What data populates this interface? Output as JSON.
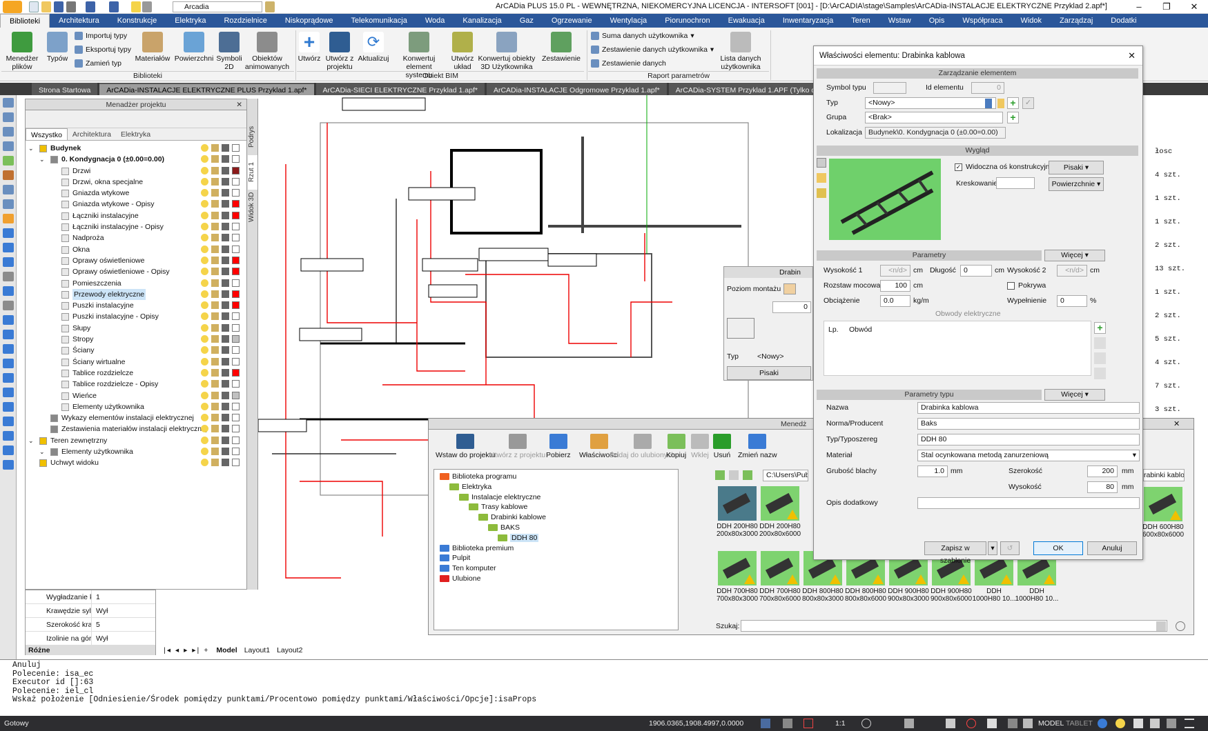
{
  "window": {
    "title": "ArCADia PLUS 15.0 PL - WEWNĘTRZNA, NIEKOMERCYJNA LICENCJA - INTERSOFT [001] - [D:\\ArCADIA\\stage\\Samples\\ArCADia-INSTALACJE ELEKTRYCZNE Przyklad 2.apf*]",
    "layer_combo": "Arcadia"
  },
  "ribbon_tabs": [
    "Biblioteki",
    "Architektura",
    "Konstrukcje",
    "Elektryka",
    "Rozdzielnice",
    "Niskoprądowe",
    "Telekomunikacja",
    "Woda",
    "Kanalizacja",
    "Gaz",
    "Ogrzewanie",
    "Wentylacja",
    "Piorunochron",
    "Ewakuacja",
    "Inwentaryzacja",
    "Teren",
    "Wstaw",
    "Opis",
    "Współpraca",
    "Widok",
    "Zarządzaj",
    "Dodatki"
  ],
  "ribbon": {
    "menedzer": "Menedżer plików",
    "typow": "Typów",
    "importuj": "Importuj typy",
    "eksportuj": "Eksportuj typy",
    "zamien": "Zamień typ",
    "materialow": "Materiałów",
    "powierzchni": "Powierzchni",
    "symboli": "Symboli 2D",
    "obiektow": "Obiektów animowanych",
    "group1": "Biblioteki",
    "utworz": "Utwórz",
    "utworz_projektu": "Utwórz z projektu",
    "aktualizuj": "Aktualizuj",
    "konwertuj": "Konwertuj element systemu",
    "utworz_uklad": "Utwórz układ",
    "konwertuj3d": "Konwertuj obiekty 3D Użytkownika",
    "zestawienie": "Zestawienie",
    "group2": "Obiekt BIM",
    "suma": "Suma danych użytkownika",
    "zest_uzyt": "Zestawienie danych użytkownika",
    "zest_danych": "Zestawienie danych",
    "lista": "Lista danych użytkownika",
    "group3": "Raport parametrów"
  },
  "doc_tabs": [
    "Strona Startowa",
    "ArCADia-INSTALACJE ELEKTRYCZNE PLUS Przyklad 1.apf*",
    "ArCADia-SIECI ELEKTRYCZNE Przyklad 1.apf*",
    "ArCADia-INSTALACJE Odgromowe Przyklad 1.apf*",
    "ArCADia-SYSTEM Przyklad 1.APF (Tylko do odczytu)*"
  ],
  "project_manager": {
    "title": "Menadżer projektu",
    "tabs": [
      "Wszystko",
      "Architektura",
      "Elektryka"
    ],
    "tree": [
      {
        "label": "Budynek",
        "level": 0,
        "bold": true
      },
      {
        "label": "0. Kondygnacja 0 (±0.00=0.00)",
        "level": 1,
        "bold": true
      },
      {
        "label": "Drzwi",
        "level": 2,
        "color": "#8b1a1a"
      },
      {
        "label": "Drzwi, okna specjalne",
        "level": 2,
        "color": "#ffffff"
      },
      {
        "label": "Gniazda wtykowe",
        "level": 2,
        "color": "#ffffff"
      },
      {
        "label": "Gniazda wtykowe - Opisy",
        "level": 2,
        "color": "#ff0000"
      },
      {
        "label": "Łączniki instalacyjne",
        "level": 2,
        "color": "#ff0000"
      },
      {
        "label": "Łączniki instalacyjne - Opisy",
        "level": 2,
        "color": "#ffffff"
      },
      {
        "label": "Nadproża",
        "level": 2,
        "color": "#ffffff"
      },
      {
        "label": "Okna",
        "level": 2,
        "color": "#ffffff"
      },
      {
        "label": "Oprawy oświetleniowe",
        "level": 2,
        "color": "#ff0000"
      },
      {
        "label": "Oprawy oświetleniowe - Opisy",
        "level": 2,
        "color": "#ff0000"
      },
      {
        "label": "Pomieszczenia",
        "level": 2,
        "color": "#ffffff"
      },
      {
        "label": "Przewody elektryczne",
        "level": 2,
        "color": "#ff0000",
        "selected": true
      },
      {
        "label": "Puszki instalacyjne",
        "level": 2,
        "color": "#ff0000"
      },
      {
        "label": "Puszki instalacyjne - Opisy",
        "level": 2,
        "color": "#ffffff"
      },
      {
        "label": "Słupy",
        "level": 2,
        "color": "#ffffff"
      },
      {
        "label": "Stropy",
        "level": 2,
        "color": "#c0c0c0"
      },
      {
        "label": "Ściany",
        "level": 2,
        "color": "#ffffff"
      },
      {
        "label": "Ściany wirtualne",
        "level": 2,
        "color": "#ffffff"
      },
      {
        "label": "Tablice rozdzielcze",
        "level": 2,
        "color": "#ff0000"
      },
      {
        "label": "Tablice rozdzielcze - Opisy",
        "level": 2,
        "color": "#ffffff"
      },
      {
        "label": "Wieńce",
        "level": 2,
        "color": "#c0c0c0"
      },
      {
        "label": "Elementy użytkownika",
        "level": 2,
        "color": "#ffffff"
      },
      {
        "label": "Wykazy elementów instalacji elektrycznej",
        "level": 1,
        "color": "#ffffff"
      },
      {
        "label": "Zestawienia materiałów instalacji elektrycznej",
        "level": 1,
        "color": "#ffffff"
      },
      {
        "label": "Teren zewnętrzny",
        "level": 0,
        "color": "#ffffff"
      },
      {
        "label": "Elementy użytkownika",
        "level": 1,
        "color": "#ffffff"
      },
      {
        "label": "Uchwyt widoku",
        "level": 0,
        "color": "#ffffff"
      }
    ]
  },
  "side_tabs": [
    "Podrys",
    "Rzut 1",
    "Widok 3D"
  ],
  "props_mini": [
    {
      "k": "Wygładzanie kr...",
      "v": "1"
    },
    {
      "k": "Krawędzie sylw...",
      "v": "Wył"
    },
    {
      "k": "Szerokość kra...",
      "v": "5"
    },
    {
      "k": "Izolinie na górze",
      "v": "Wył"
    }
  ],
  "props_mini_footer": "Różne",
  "layout_tabs": [
    "Model",
    "Layout1",
    "Layout2"
  ],
  "drabinka_mini": {
    "title": "Drabin",
    "poziom": "Poziom montażu",
    "typ_label": "Typ",
    "typ": "<Nowy>",
    "pisaki": "Pisaki",
    "val": "0"
  },
  "dialog": {
    "title": "Właściwości elementu: Drabinka kablowa",
    "sec_zarzadzanie": "Zarządzanie elementem",
    "symbol_typu": "Symbol typu",
    "id_elementu": "Id elementu",
    "id_value": "0",
    "typ_label": "Typ",
    "typ_value": "<Nowy>",
    "grupa_label": "Grupa",
    "grupa_value": "<Brak>",
    "lokalizacja_label": "Lokalizacja",
    "lokalizacja_value": "Budynek\\0. Kondygnacja 0 (±0.00=0.00)",
    "sec_wyglad": "Wygląd",
    "widoczna": "Widoczna oś konstrukcyjna",
    "pisaki": "Pisaki",
    "kreskowanie": "Kreskowanie",
    "powierzchnie": "Powierzchnie",
    "sec_parametry": "Parametry",
    "wiecej": "Więcej",
    "wysokosc1": "Wysokość 1",
    "nd": "<n/d>",
    "cm": "cm",
    "dlugosc": "Długość",
    "dlugosc_v": "0",
    "wysokosc2": "Wysokość 2",
    "rozstaw": "Rozstaw mocowań",
    "rozstaw_v": "100",
    "pokrywa": "Pokrywa",
    "obciazenie": "Obciążenie",
    "obciazenie_v": "0.0",
    "kgm": "kg/m",
    "wypelnienie": "Wypełnienie",
    "wypelnienie_v": "0",
    "pct": "%",
    "obwody": "Obwody elektryczne",
    "lp": "Lp.",
    "obwod": "Obwód",
    "sec_param_typu": "Parametry typu",
    "nazwa": "Nazwa",
    "nazwa_v": "Drabinka kablowa",
    "norma": "Norma/Producent",
    "norma_v": "Baks",
    "typ_typoszereg": "Typ/Typoszereg",
    "typ_typoszereg_v": "DDH 80",
    "material": "Materiał",
    "material_v": "Stal ocynkowana metodą zanurzeniową",
    "grubosc": "Grubość blachy",
    "grubosc_v": "1.0",
    "mm": "mm",
    "szerokosc": "Szerokość",
    "szerokosc_v": "200",
    "wysokosc": "Wysokość",
    "wysokosc_v": "80",
    "opis": "Opis dodatkowy",
    "zapisz": "Zapisz w szablonie",
    "ok": "OK",
    "anuluj": "Anuluj"
  },
  "library": {
    "title": "Menedż",
    "tools": [
      "Wstaw do projektu",
      "Utwórz z projektu",
      "Pobierz",
      "Właściwości",
      "Dodaj do ulubionych",
      "Kopiuj",
      "Wklej",
      "Usuń",
      "Zmień nazw"
    ],
    "path": "C:\\Users\\Public\\",
    "path_right": "rabinki kablowe\\BAKS",
    "tree": [
      {
        "label": "Biblioteka programu",
        "level": 0
      },
      {
        "label": "Elektryka",
        "level": 1
      },
      {
        "label": "Instalacje elektryczne",
        "level": 2
      },
      {
        "label": "Trasy kablowe",
        "level": 3
      },
      {
        "label": "Drabinki kablowe",
        "level": 4
      },
      {
        "label": "BAKS",
        "level": 5
      },
      {
        "label": "DDH 80",
        "level": 6,
        "selected": true
      },
      {
        "label": "Biblioteka premium",
        "level": 0
      },
      {
        "label": "Pulpit",
        "level": 0
      },
      {
        "label": "Ten komputer",
        "level": 0
      },
      {
        "label": "Ulubione",
        "level": 0
      }
    ],
    "thumbs_row1": [
      {
        "l1": "DDH 200H80",
        "l2": "200x80x3000"
      },
      {
        "l1": "DDH 200H80",
        "l2": "200x80x6000"
      }
    ],
    "thumb_right": {
      "l1": "DDH 600H80",
      "l2": "600x80x6000"
    },
    "thumbs_row2": [
      {
        "l1": "DDH 700H80",
        "l2": "700x80x3000"
      },
      {
        "l1": "DDH 700H80",
        "l2": "700x80x6000"
      },
      {
        "l1": "DDH 800H80",
        "l2": "800x80x3000"
      },
      {
        "l1": "DDH 800H80",
        "l2": "800x80x6000"
      },
      {
        "l1": "DDH 900H80",
        "l2": "900x80x3000"
      },
      {
        "l1": "DDH 900H80",
        "l2": "900x80x6000"
      },
      {
        "l1": "DDH",
        "l2": "1000H80 10..."
      },
      {
        "l1": "DDH",
        "l2": "1000H80 10..."
      }
    ],
    "search_label": "Szukaj:"
  },
  "bg_table": [
    "łosc",
    "4 szt.",
    "1 szt.",
    "1 szt.",
    "2 szt.",
    "13 szt.",
    "1 szt.",
    "2 szt.",
    "5 szt.",
    "4 szt.",
    "7 szt.",
    "3 szt."
  ],
  "command_lines": [
    "Anuluj",
    "Polecenie: isa_ec",
    "Executor id []:63",
    "Polecenie: iel_cl",
    "Wskaż położenie [Odniesienie/Środek pomiędzy punktami/Procentowo pomiędzy punktami/Właściwości/Opcje]:isaProps"
  ],
  "status": {
    "ready": "Gotowy",
    "coords": "1906.0365,1908.4997,0.0000",
    "scale": "1:1",
    "model": "MODEL",
    "tablet": "TABLET"
  },
  "colors": {
    "ribbon_blue": "#2b579a",
    "accent_green": "#2a9d2a",
    "warn": "#f0c000"
  }
}
